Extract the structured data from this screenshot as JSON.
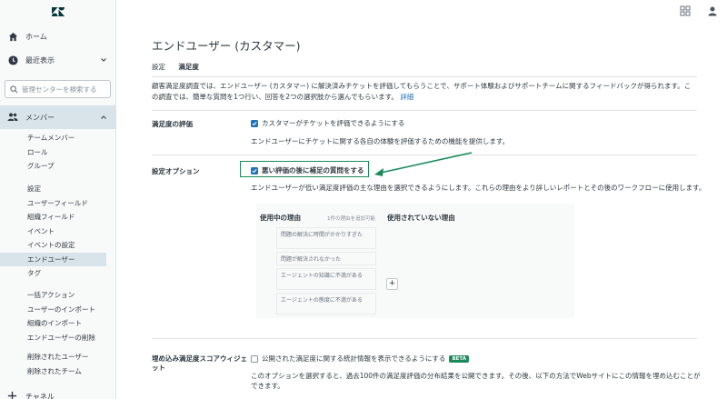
{
  "topbar": {
    "apps_icon": "grid-icon",
    "user_icon": "user-icon"
  },
  "sidebar": {
    "home_label": "ホーム",
    "recent_label": "最近表示",
    "search_placeholder": "管理センターを検索する",
    "members_label": "メンバー",
    "groups": [
      {
        "items": [
          "チームメンバー",
          "ロール",
          "グループ"
        ]
      },
      {
        "head": "設定",
        "items": [
          "ユーザーフィールド",
          "組織フィールド",
          "イベント",
          "イベントの設定",
          "エンドユーザー",
          "タグ"
        ]
      },
      {
        "head": "一括アクション",
        "items": [
          "ユーザーのインポート",
          "組織のインポート",
          "エンドユーザーの削除"
        ]
      },
      {
        "items": [
          "削除されたユーザー",
          "削除されたチーム"
        ]
      }
    ],
    "active_item": "エンドユーザー",
    "channels_label": "チャネル"
  },
  "main": {
    "title": "エンドユーザー (カスタマー)",
    "breadcrumb": {
      "parent": "設定",
      "current": "満足度"
    },
    "intro_text": "顧客満足度調査では、エンドユーザー (カスタマー) に解決済みチケットを評価してもらうことで、サポート体験およびサポートチームに関するフィードバックが得られます。この調査では、簡単な質問を1つ行い、回答を2つの選択肢から選んでもらいます。",
    "intro_link": "詳細",
    "rating_section": {
      "label": "満足度の評価",
      "checkbox_label": "カスタマーがチケットを評価できるようにする",
      "checked": true,
      "hint": "エンドユーザーにチケットに関する各自の体験を評価するための機能を提供します。"
    },
    "options_section": {
      "label": "設定オプション",
      "checkbox_label": "悪い評価の後に補足の質問をする",
      "checked": true,
      "hint": "エンドユーザーが低い満足度評価の主な理由を選択できるようにします。これらの理由をより詳しいレポートとその後のワークフローに使用します。"
    },
    "reasons": {
      "in_use_label": "使用中の理由",
      "in_use_note": "1件の理由を追加可能",
      "unused_label": "使用されていない理由",
      "cards": [
        "問題の解決に時間がかかりすぎた",
        "問題が解決されなかった",
        "エージェントの知識に不満がある",
        "エージェントの態度に不満がある"
      ],
      "add_button": "+"
    },
    "widget_section": {
      "label": "埋め込み満足度スコアウィジェット",
      "checkbox_label": "公開された満足度に関する統計情報を表示できるようにする",
      "checked": false,
      "beta": "BETA",
      "hint": "このオプションを選択すると、過去100件の満足度評価の分布結果を公開できます。その後、以下の方法でWebサイトにこの情報を埋め込むことができます。"
    }
  }
}
